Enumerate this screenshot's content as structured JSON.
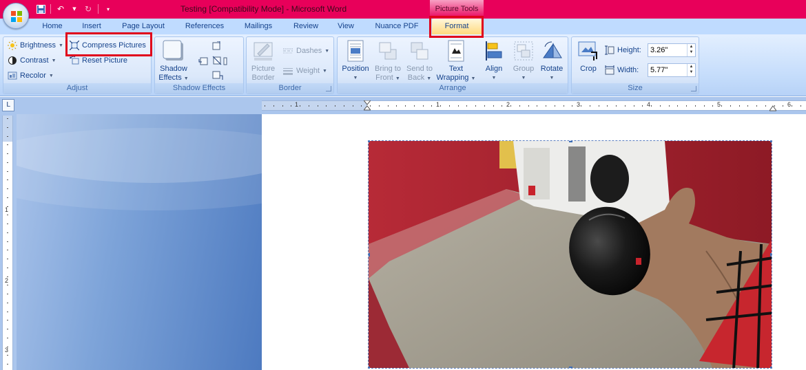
{
  "window": {
    "title": "Testing [Compatibility Mode] - Microsoft Word",
    "contextual_tab_group": "Picture Tools"
  },
  "quick_access_toolbar": {
    "items": [
      "save-icon",
      "undo-icon",
      "redo-icon",
      "customize-icon"
    ]
  },
  "tabs": [
    "Home",
    "Insert",
    "Page Layout",
    "References",
    "Mailings",
    "Review",
    "View",
    "Nuance PDF",
    "Format"
  ],
  "active_tab": "Format",
  "ribbon": {
    "adjust": {
      "label": "Adjust",
      "brightness": "Brightness",
      "contrast": "Contrast",
      "recolor": "Recolor",
      "compress": "Compress Pictures",
      "reset": "Reset Picture"
    },
    "shadow": {
      "label": "Shadow Effects",
      "button_line1": "Shadow",
      "button_line2": "Effects"
    },
    "border": {
      "label": "Border",
      "picture_border_line1": "Picture",
      "picture_border_line2": "Border",
      "dashes": "Dashes",
      "weight": "Weight"
    },
    "arrange": {
      "label": "Arrange",
      "position": "Position",
      "bring_front_line1": "Bring to",
      "bring_front_line2": "Front",
      "send_back_line1": "Send to",
      "send_back_line2": "Back",
      "text_wrap_line1": "Text",
      "text_wrap_line2": "Wrapping",
      "align": "Align",
      "group": "Group",
      "rotate": "Rotate"
    },
    "size": {
      "label": "Size",
      "crop": "Crop",
      "height_label": "Height:",
      "height_value": "3.26\"",
      "width_label": "Width:",
      "width_value": "5.77\""
    }
  },
  "ruler": {
    "corner": "L",
    "h_numbers": [
      "1",
      "1",
      "2",
      "3",
      "4",
      "5",
      "6"
    ],
    "v_numbers": [
      "1",
      "2",
      "3"
    ]
  },
  "colors": {
    "titlebar": "#e8005a",
    "highlight": "#e0001b",
    "tab_bar": "#bfdbff"
  }
}
